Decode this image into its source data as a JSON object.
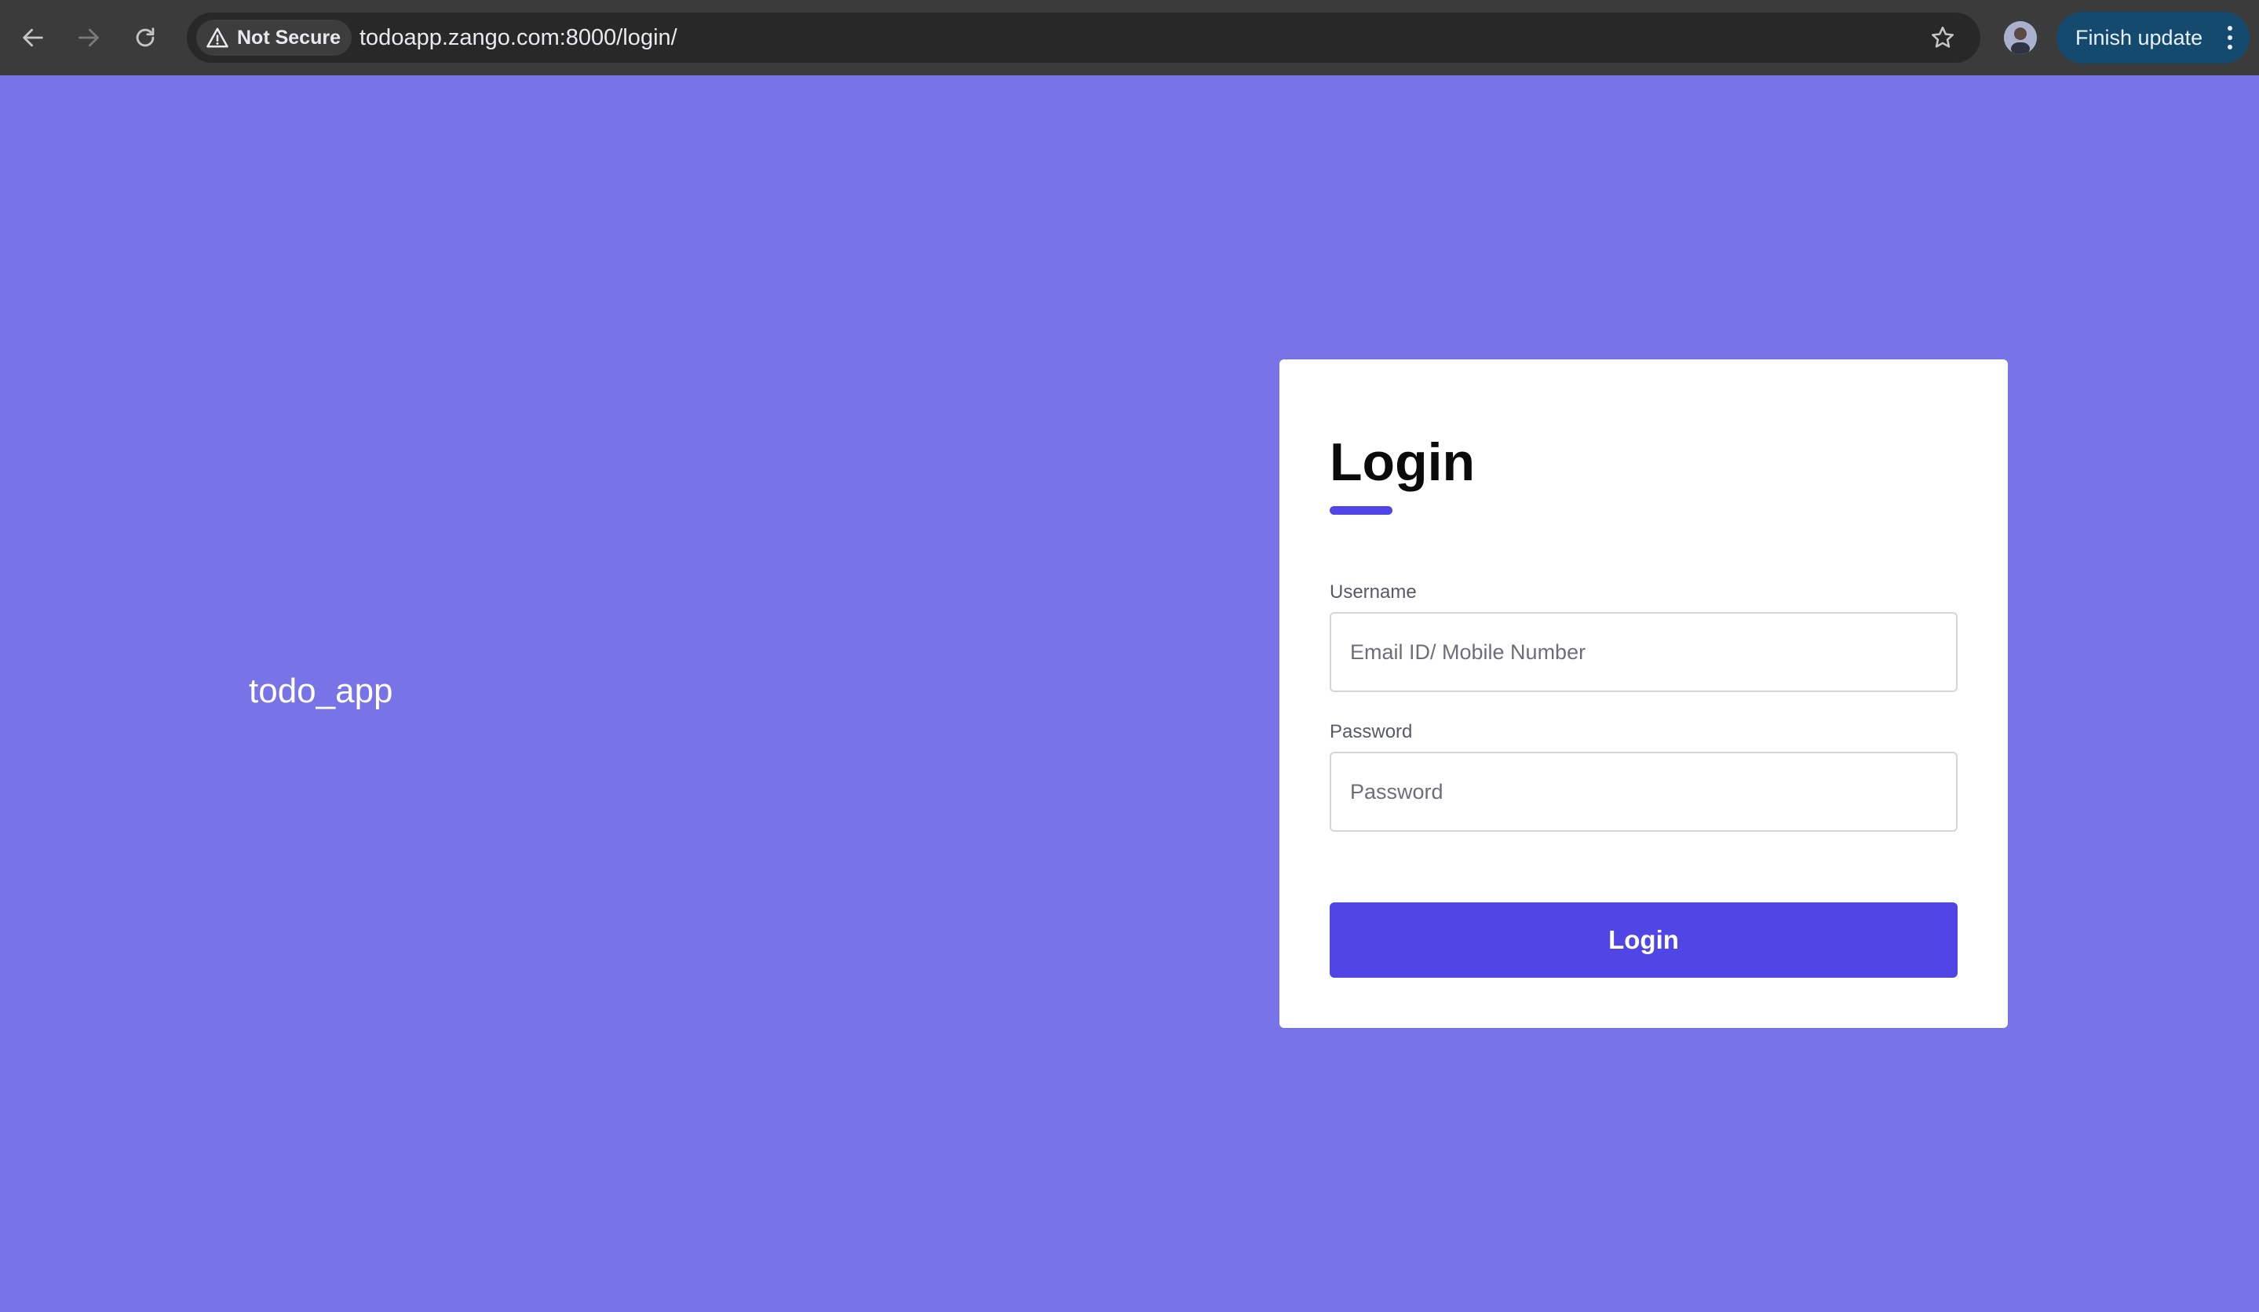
{
  "browser": {
    "security_label": "Not Secure",
    "url": "todoapp.zango.com:8000/login/",
    "update_button_label": "Finish update"
  },
  "icons": {
    "back": "arrow-left-icon",
    "forward": "arrow-right-icon",
    "reload": "reload-icon",
    "security": "warning-triangle-icon",
    "bookmark": "star-icon",
    "profile": "avatar",
    "menu": "kebab-menu-icon"
  },
  "page": {
    "app_name": "todo_app"
  },
  "login": {
    "title": "Login",
    "username_label": "Username",
    "username_placeholder": "Email ID/ Mobile Number",
    "username_value": "",
    "password_label": "Password",
    "password_placeholder": "Password",
    "password_value": "",
    "submit_label": "Login"
  },
  "colors": {
    "page_background": "#7873e6",
    "accent": "#4f46e5",
    "card_background": "#ffffff",
    "toolbar": "#3b3b3b"
  }
}
